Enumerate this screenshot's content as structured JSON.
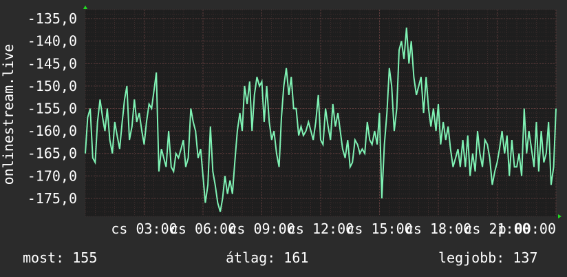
{
  "colors": {
    "background": "#2b2b2b",
    "plot_background": "#1e1e1e",
    "grid": "#5a3a3a",
    "line": "#7ff2b4",
    "arrow": "#22dd22"
  },
  "stats": {
    "now": "most: 155",
    "avg": "átlag: 161",
    "best": "legjobb: 137"
  },
  "chart_data": {
    "type": "line",
    "ylabel": "onlinestream.live",
    "ylim": [
      -179,
      -133
    ],
    "xlim": [
      0,
      24
    ],
    "y_ticks": [
      -135,
      -140,
      -145,
      -150,
      -155,
      -160,
      -165,
      -170,
      -175
    ],
    "y_tick_labels": [
      "-135,0",
      "-140,0",
      "-145,0",
      "-150,0",
      "-155,0",
      "-160,0",
      "-165,0",
      "-170,0",
      "-175,0"
    ],
    "x_ticks": [
      3,
      6,
      9,
      12,
      15,
      18,
      21,
      24
    ],
    "x_tick_labels": [
      "cs 03:00",
      "cs 06:00",
      "cs 09:00",
      "cs 12:00",
      "cs 15:00",
      "cs 18:00",
      "cs 21:00",
      "p 00:00"
    ],
    "grid": true,
    "series": [
      {
        "values": [
          [
            0.0,
            -165
          ],
          [
            0.12,
            -157
          ],
          [
            0.25,
            -155
          ],
          [
            0.38,
            -166
          ],
          [
            0.5,
            -167
          ],
          [
            0.62,
            -158
          ],
          [
            0.75,
            -153
          ],
          [
            0.88,
            -157
          ],
          [
            1.0,
            -160
          ],
          [
            1.12,
            -155
          ],
          [
            1.25,
            -162
          ],
          [
            1.38,
            -165
          ],
          [
            1.5,
            -158
          ],
          [
            1.62,
            -161
          ],
          [
            1.75,
            -164
          ],
          [
            1.88,
            -158
          ],
          [
            2.0,
            -153
          ],
          [
            2.12,
            -150
          ],
          [
            2.25,
            -162
          ],
          [
            2.38,
            -159
          ],
          [
            2.5,
            -153
          ],
          [
            2.62,
            -158
          ],
          [
            2.75,
            -156
          ],
          [
            2.88,
            -160
          ],
          [
            3.0,
            -163
          ],
          [
            3.12,
            -158
          ],
          [
            3.25,
            -154
          ],
          [
            3.38,
            -155
          ],
          [
            3.5,
            -151
          ],
          [
            3.62,
            -147
          ],
          [
            3.75,
            -169
          ],
          [
            3.88,
            -164
          ],
          [
            4.0,
            -166
          ],
          [
            4.12,
            -168
          ],
          [
            4.25,
            -160
          ],
          [
            4.38,
            -168
          ],
          [
            4.5,
            -169
          ],
          [
            4.62,
            -165
          ],
          [
            4.75,
            -166
          ],
          [
            4.88,
            -164
          ],
          [
            5.0,
            -162
          ],
          [
            5.12,
            -168
          ],
          [
            5.25,
            -166
          ],
          [
            5.38,
            -155
          ],
          [
            5.5,
            -158
          ],
          [
            5.62,
            -160
          ],
          [
            5.75,
            -166
          ],
          [
            5.88,
            -164
          ],
          [
            6.0,
            -170
          ],
          [
            6.12,
            -176
          ],
          [
            6.25,
            -172
          ],
          [
            6.38,
            -159
          ],
          [
            6.5,
            -169
          ],
          [
            6.62,
            -172
          ],
          [
            6.75,
            -176
          ],
          [
            6.88,
            -178
          ],
          [
            7.0,
            -175
          ],
          [
            7.12,
            -170
          ],
          [
            7.25,
            -174
          ],
          [
            7.38,
            -171
          ],
          [
            7.5,
            -174
          ],
          [
            7.62,
            -167
          ],
          [
            7.75,
            -160
          ],
          [
            7.88,
            -156
          ],
          [
            8.0,
            -160
          ],
          [
            8.12,
            -150
          ],
          [
            8.25,
            -154
          ],
          [
            8.38,
            -149
          ],
          [
            8.5,
            -160
          ],
          [
            8.62,
            -152
          ],
          [
            8.75,
            -148
          ],
          [
            8.88,
            -150
          ],
          [
            9.0,
            -149
          ],
          [
            9.12,
            -158
          ],
          [
            9.25,
            -150
          ],
          [
            9.38,
            -158
          ],
          [
            9.5,
            -162
          ],
          [
            9.62,
            -160
          ],
          [
            9.75,
            -165
          ],
          [
            9.88,
            -168
          ],
          [
            10.0,
            -157
          ],
          [
            10.12,
            -150
          ],
          [
            10.25,
            -146
          ],
          [
            10.38,
            -152
          ],
          [
            10.5,
            -148
          ],
          [
            10.62,
            -155
          ],
          [
            10.75,
            -155
          ],
          [
            10.88,
            -161
          ],
          [
            11.0,
            -159
          ],
          [
            11.12,
            -161
          ],
          [
            11.25,
            -160
          ],
          [
            11.38,
            -158
          ],
          [
            11.5,
            -160
          ],
          [
            11.62,
            -162
          ],
          [
            11.75,
            -158
          ],
          [
            11.88,
            -152
          ],
          [
            12.0,
            -162
          ],
          [
            12.12,
            -163
          ],
          [
            12.25,
            -155
          ],
          [
            12.38,
            -159
          ],
          [
            12.5,
            -162
          ],
          [
            12.62,
            -154
          ],
          [
            12.75,
            -159
          ],
          [
            12.88,
            -156
          ],
          [
            13.0,
            -160
          ],
          [
            13.12,
            -164
          ],
          [
            13.25,
            -166
          ],
          [
            13.38,
            -162
          ],
          [
            13.5,
            -168
          ],
          [
            13.62,
            -167
          ],
          [
            13.75,
            -162
          ],
          [
            13.88,
            -163
          ],
          [
            14.0,
            -165
          ],
          [
            14.12,
            -164
          ],
          [
            14.25,
            -165
          ],
          [
            14.38,
            -158
          ],
          [
            14.5,
            -162
          ],
          [
            14.62,
            -163
          ],
          [
            14.75,
            -160
          ],
          [
            14.88,
            -163
          ],
          [
            15.0,
            -156
          ],
          [
            15.12,
            -175
          ],
          [
            15.25,
            -163
          ],
          [
            15.38,
            -156
          ],
          [
            15.5,
            -146
          ],
          [
            15.62,
            -150
          ],
          [
            15.75,
            -160
          ],
          [
            15.88,
            -155
          ],
          [
            16.0,
            -142
          ],
          [
            16.12,
            -140
          ],
          [
            16.25,
            -144
          ],
          [
            16.38,
            -137
          ],
          [
            16.5,
            -145
          ],
          [
            16.62,
            -140
          ],
          [
            16.75,
            -148
          ],
          [
            16.88,
            -152
          ],
          [
            17.0,
            -150
          ],
          [
            17.12,
            -148
          ],
          [
            17.25,
            -156
          ],
          [
            17.38,
            -148
          ],
          [
            17.5,
            -155
          ],
          [
            17.62,
            -159
          ],
          [
            17.75,
            -155
          ],
          [
            17.88,
            -160
          ],
          [
            18.0,
            -154
          ],
          [
            18.12,
            -163
          ],
          [
            18.25,
            -158
          ],
          [
            18.38,
            -162
          ],
          [
            18.5,
            -159
          ],
          [
            18.62,
            -164
          ],
          [
            18.75,
            -168
          ],
          [
            18.88,
            -166
          ],
          [
            19.0,
            -164
          ],
          [
            19.12,
            -168
          ],
          [
            19.25,
            -162
          ],
          [
            19.38,
            -168
          ],
          [
            19.5,
            -161
          ],
          [
            19.62,
            -170
          ],
          [
            19.75,
            -165
          ],
          [
            19.88,
            -169
          ],
          [
            20.0,
            -160
          ],
          [
            20.12,
            -165
          ],
          [
            20.25,
            -168
          ],
          [
            20.38,
            -162
          ],
          [
            20.5,
            -163
          ],
          [
            20.62,
            -166
          ],
          [
            20.75,
            -172
          ],
          [
            20.88,
            -169
          ],
          [
            21.0,
            -167
          ],
          [
            21.12,
            -164
          ],
          [
            21.25,
            -160
          ],
          [
            21.38,
            -165
          ],
          [
            21.5,
            -161
          ],
          [
            21.62,
            -170
          ],
          [
            21.75,
            -162
          ],
          [
            21.88,
            -168
          ],
          [
            22.0,
            -168
          ],
          [
            22.12,
            -165
          ],
          [
            22.25,
            -170
          ],
          [
            22.38,
            -155
          ],
          [
            22.5,
            -165
          ],
          [
            22.62,
            -160
          ],
          [
            22.75,
            -164
          ],
          [
            22.88,
            -168
          ],
          [
            23.0,
            -158
          ],
          [
            23.12,
            -169
          ],
          [
            23.25,
            -160
          ],
          [
            23.38,
            -167
          ],
          [
            23.5,
            -165
          ],
          [
            23.62,
            -158
          ],
          [
            23.75,
            -172
          ],
          [
            23.88,
            -168
          ],
          [
            24.0,
            -155
          ]
        ]
      }
    ]
  }
}
